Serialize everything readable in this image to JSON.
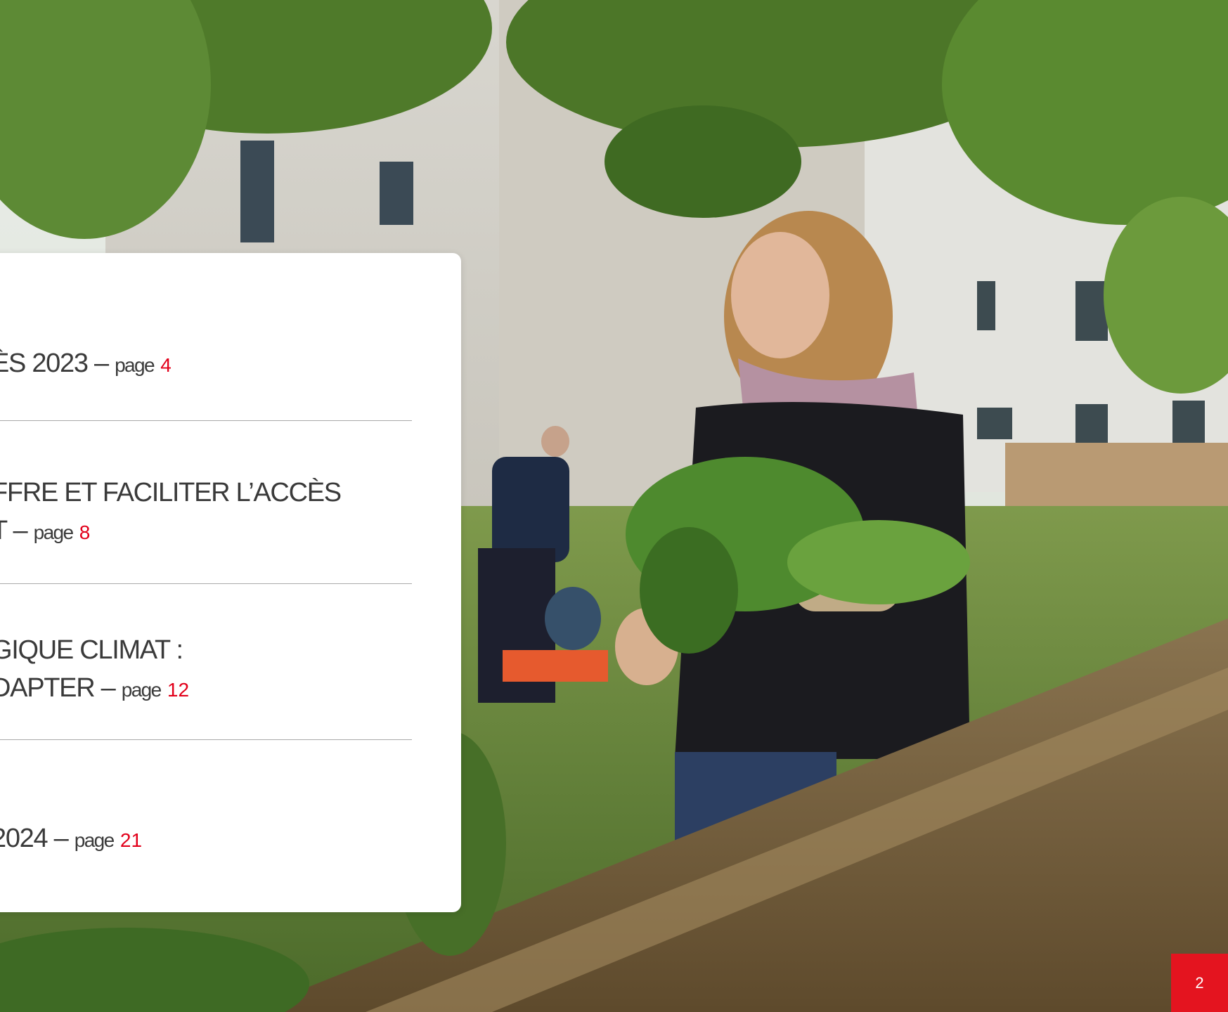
{
  "toc": [
    {
      "lines": [
        "ÈS 2023"
      ],
      "page_label": "page",
      "page_number": "4"
    },
    {
      "lines": [
        "FFRE ET FACILITER L’ACCÈS",
        "T"
      ],
      "page_label": "page",
      "page_number": "8"
    },
    {
      "lines": [
        "GIQUE CLIMAT :",
        "DAPTER"
      ],
      "page_label": "page",
      "page_number": "12"
    },
    {
      "lines": [
        "2024"
      ],
      "page_label": "page",
      "page_number": "21"
    }
  ],
  "separator": "–",
  "page_badge": "2",
  "colors": {
    "accent": "#e2001a",
    "text": "#3a3a3a",
    "card": "#ffffff",
    "badge": "#e4141f"
  }
}
